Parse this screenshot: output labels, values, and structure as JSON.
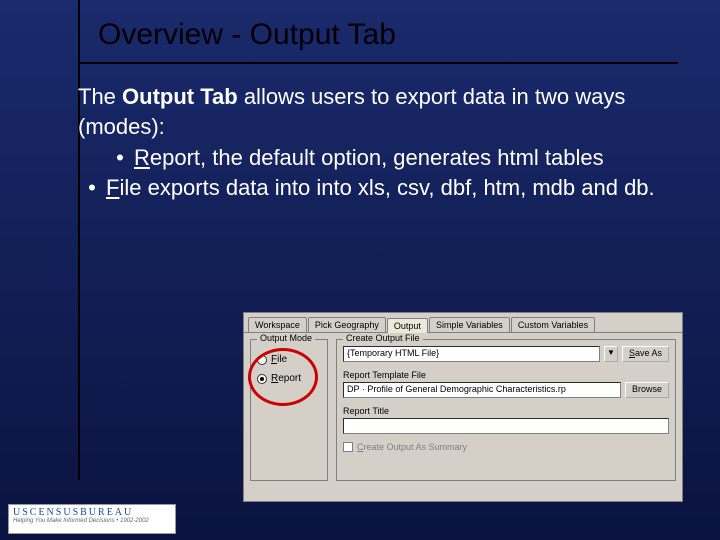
{
  "title": "Overview - Output Tab",
  "body": {
    "lead_pre": "The ",
    "lead_bold": "Output Tab",
    "lead_post": " allows users to export data in two ways (modes):",
    "b1_under": "R",
    "b1_rest": "eport",
    "b1_tail": ", the default option, generates html tables",
    "b2_under": "F",
    "b2_rest": "ile",
    "b2_tail": " exports data into into xls, csv, dbf, htm, mdb and db."
  },
  "shot": {
    "tabs": [
      "Workspace",
      "Pick Geography",
      "Output",
      "Simple Variables",
      "Custom Variables"
    ],
    "outmode_label": "Output Mode",
    "radio_file_u": "F",
    "radio_file_r": "ile",
    "radio_report_u": "R",
    "radio_report_r": "eport",
    "createfile_label": "Create Output File",
    "filename": "{Temporary HTML File}",
    "saveas_u": "S",
    "saveas_r": "ave As",
    "tpl_label": "Report Template File",
    "tpl_value": "DP · Profile of General Demographic Characteristics.rp",
    "browse": "Browse",
    "title_label": "Report Title",
    "summary_u": "C",
    "summary_r": "reate Output As Summary"
  },
  "footer": {
    "line1": "USCENSUSBUREAU",
    "line2": "Helping You Make Informed Decisions • 1902-2002"
  }
}
